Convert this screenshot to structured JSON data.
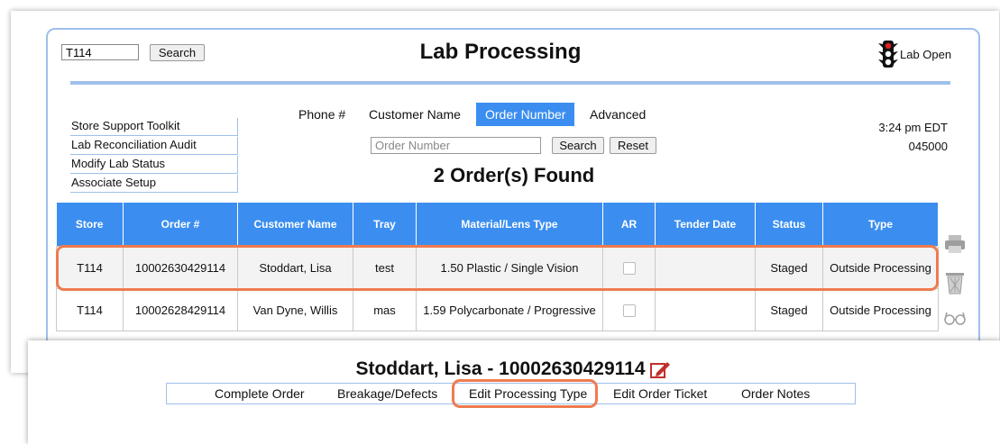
{
  "header": {
    "search_value": "T114",
    "search_button": "Search",
    "title": "Lab Processing",
    "lab_status": "Lab Open"
  },
  "sidebar": {
    "links": [
      "Store Support Toolkit",
      "Lab Reconciliation Audit",
      "Modify Lab Status",
      "Associate Setup"
    ]
  },
  "search_tabs": {
    "phone": "Phone #",
    "customer_name": "Customer Name",
    "order_number": "Order Number",
    "advanced": "Advanced",
    "active": "order_number"
  },
  "order_search": {
    "placeholder": "Order Number",
    "search_button": "Search",
    "reset_button": "Reset"
  },
  "info": {
    "time": "3:24 pm EDT",
    "code": "045000"
  },
  "results": {
    "found_text": "2 Order(s) Found",
    "columns": [
      "Store",
      "Order #",
      "Customer Name",
      "Tray",
      "Material/Lens Type",
      "AR",
      "Tender Date",
      "Status",
      "Type"
    ],
    "rows": [
      {
        "store": "T114",
        "order": "10002630429114",
        "customer": "Stoddart, Lisa",
        "tray": "test",
        "material": "1.50 Plastic / Single Vision",
        "tender_date": "",
        "status": "Staged",
        "type": "Outside Processing"
      },
      {
        "store": "T114",
        "order": "10002628429114",
        "customer": "Van Dyne, Willis",
        "tray": "mas",
        "material": "1.59 Polycarbonate / Progressive",
        "tender_date": "",
        "status": "Staged",
        "type": "Outside Processing"
      }
    ]
  },
  "detail": {
    "title": "Stoddart, Lisa - 10002630429114",
    "actions": [
      "Complete Order",
      "Breakage/Defects",
      "Edit Processing Type",
      "Edit Order Ticket",
      "Order Notes"
    ]
  },
  "icons": {
    "traffic_light": "traffic-light-icon",
    "printer": "printer-icon",
    "trash": "trash-icon",
    "glasses": "glasses-icon",
    "edit": "edit-icon"
  },
  "colors": {
    "accent": "#3b8ef0",
    "panel_border": "#9ec0ea",
    "highlight": "#ef7b4f"
  }
}
